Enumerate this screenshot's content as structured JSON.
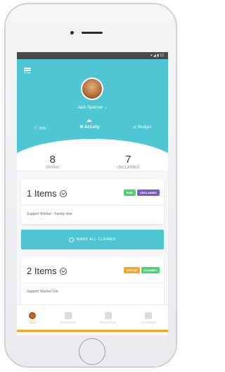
{
  "status_bar": {
    "icons": "▾ ◢ ▮ 12"
  },
  "header": {
    "user_name": "Jack Sparrow ⌄",
    "menu": [
      {
        "label": "ⓘ Info"
      },
      {
        "label": "⚒ Activity"
      },
      {
        "label": "⇄ Budget"
      }
    ]
  },
  "stats": [
    {
      "value": "8",
      "label": "UNPAID"
    },
    {
      "value": "7",
      "label": "UNCLAIMED"
    }
  ],
  "cards": [
    {
      "title": "1 Items",
      "badges": [
        {
          "label": "PAID",
          "color": "#4cd27a"
        },
        {
          "label": "UNCLAIMED",
          "color": "#7a5ac8"
        }
      ],
      "subtitle": "Support Worker - Family time"
    },
    {
      "title": "2 Items",
      "badges": [
        {
          "label": "UNPAID",
          "color": "#f5a623"
        },
        {
          "label": "CLAIMED",
          "color": "#4cd27a"
        }
      ],
      "subtitle": "Support Worker Out"
    }
  ],
  "claim_button": {
    "label": "MARK ALL CLAIMED"
  },
  "tabs": [
    {
      "label": "JACK"
    },
    {
      "label": "EXPENSES"
    },
    {
      "label": "REFERRALS"
    },
    {
      "label": "CALENDAR"
    }
  ],
  "colors": {
    "accent": "#4ec6d4",
    "orange": "#f5a623"
  }
}
